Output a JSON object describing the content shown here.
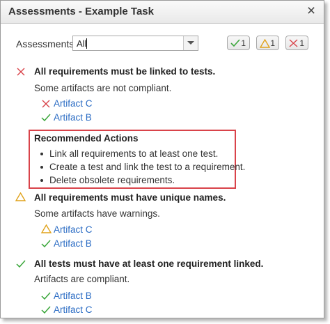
{
  "window": {
    "title": "Assessments - Example Task",
    "close_glyph": "×"
  },
  "filter": {
    "label": "Assessments:",
    "value": "All"
  },
  "counts": {
    "pass": "1",
    "warning": "1",
    "fail": "1"
  },
  "colors": {
    "pass": "#3aa63a",
    "warning": "#e0a21a",
    "fail": "#d9434a",
    "link": "#2b6cc4",
    "highlight": "#d9434a"
  },
  "assessments": [
    {
      "status": "fail",
      "title": "All requirements must be linked to tests.",
      "description": "Some artifacts are not compliant.",
      "artifacts": [
        {
          "status": "fail",
          "name": "Artifact C"
        },
        {
          "status": "pass",
          "name": "Artifact B"
        }
      ],
      "recommended": {
        "title": "Recommended Actions",
        "items": [
          "Link all requirements to at least one test.",
          "Create a test and link the test to a requirement.",
          "Delete obsolete requirements."
        ]
      }
    },
    {
      "status": "warning",
      "title": "All requirements must have unique names.",
      "description": "Some artifacts have warnings.",
      "artifacts": [
        {
          "status": "warning",
          "name": "Artifact C"
        },
        {
          "status": "pass",
          "name": "Artifact B"
        }
      ]
    },
    {
      "status": "pass",
      "title": "All tests must have at least one requirement linked.",
      "description": "Artifacts are compliant.",
      "artifacts": [
        {
          "status": "pass",
          "name": "Artifact B"
        },
        {
          "status": "pass",
          "name": "Artifact C"
        }
      ]
    }
  ]
}
